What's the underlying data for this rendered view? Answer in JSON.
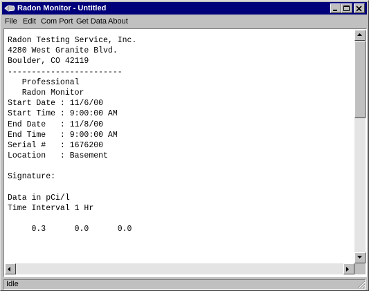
{
  "window": {
    "title": "Radon Monitor - Untitled"
  },
  "menu": [
    "File",
    "Edit",
    "Com Port",
    "Get Data",
    "About"
  ],
  "report_lines": [
    "Radon Testing Service, Inc.",
    "4280 West Granite Blvd.",
    "Boulder, CO 42119",
    "------------------------",
    "   Professional",
    "   Radon Monitor",
    "Start Date : 11/6/00",
    "Start Time : 9:00:00 AM",
    "End Date   : 11/8/00",
    "End Time   : 9:00:00 AM",
    "Serial #   : 1676200",
    "Location   : Basement",
    "",
    "Signature:",
    "",
    "Data in pCi/l",
    "Time Interval 1 Hr",
    "",
    "     0.3      0.0      0.0"
  ],
  "status": {
    "text": "Idle"
  },
  "colors": {
    "titlebar": "#00007b",
    "face": "#c0c0c0"
  }
}
